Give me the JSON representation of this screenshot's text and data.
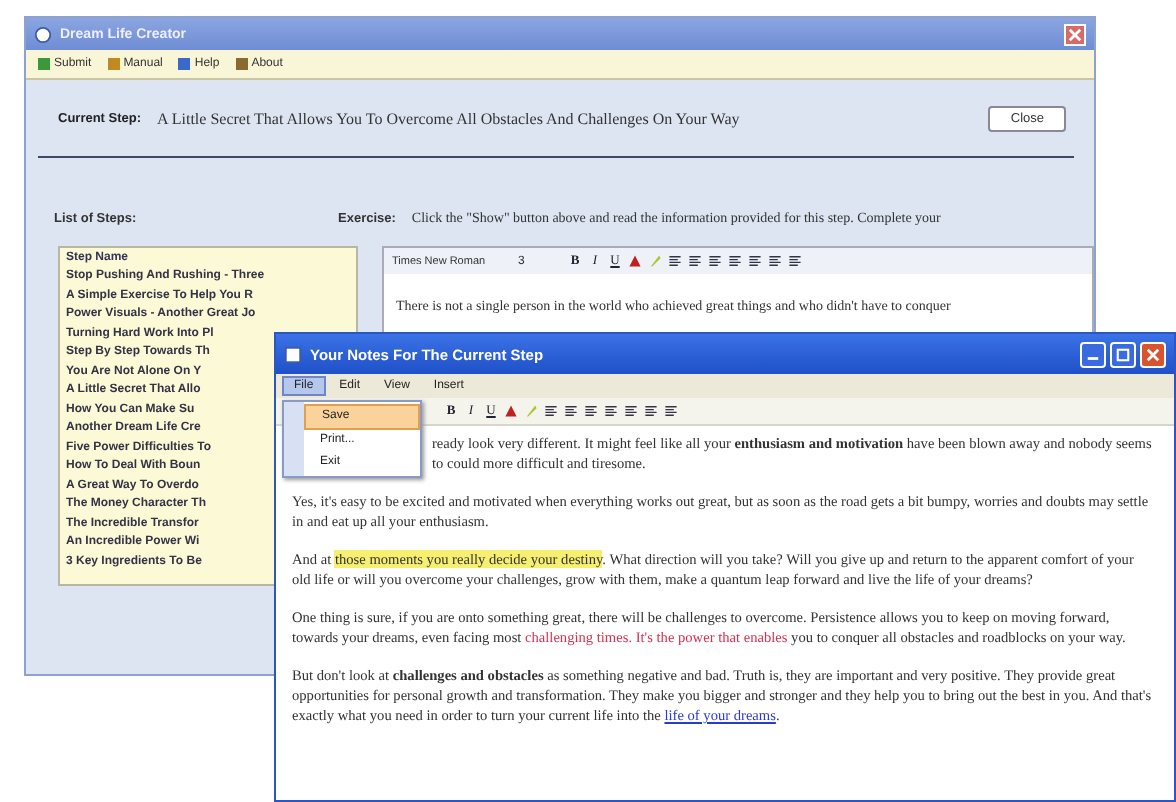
{
  "main_window": {
    "title": "Dream Life Creator",
    "toolbar": [
      {
        "label": "Submit",
        "color": "#3a9a3a"
      },
      {
        "label": "Manual",
        "color": "#c08a20"
      },
      {
        "label": "Help",
        "color": "#3a6ac8"
      },
      {
        "label": "About",
        "color": "#8a6a30"
      }
    ],
    "current_step": {
      "label": "Current Step:",
      "value": "A Little Secret That Allows You To Overcome All Obstacles And Challenges On Your Way"
    },
    "close_button": "Close",
    "steps": {
      "label": "List of Steps:",
      "header": "Step Name",
      "items": [
        "Stop Pushing And Rushing - Three",
        "A Simple Exercise To Help You R",
        "Power Visuals - Another Great Jo",
        "Turning Hard Work Into Pl",
        "Step By Step Towards Th",
        "You Are Not Alone On Y",
        "A Little Secret That Allo",
        "How You Can Make Su",
        "Another Dream Life Cre",
        "Five Power Difficulties To",
        "How To Deal With Boun",
        "A Great Way To Overdo",
        "The Money Character Th",
        "The Incredible Transfor",
        "An Incredible Power Wi",
        "3 Key Ingredients To Be"
      ]
    },
    "exercise": {
      "label": "Exercise:",
      "text": "Click the \"Show\" button above and read the information provided for this step. Complete your"
    },
    "editor": {
      "font": "Times New Roman",
      "size": "3",
      "format_buttons": [
        "B",
        "I",
        "U"
      ],
      "text": "There is not a single person in the world who achieved great things and who didn't have to conquer"
    }
  },
  "notes_window": {
    "title": "Your Notes For The Current Step",
    "menu": [
      {
        "label": "File",
        "selected": true
      },
      {
        "label": "Edit",
        "selected": false
      },
      {
        "label": "View",
        "selected": false
      },
      {
        "label": "Insert",
        "selected": false
      }
    ],
    "file_menu": [
      {
        "label": "Save",
        "selected": true
      },
      {
        "label": "Print...",
        "selected": false
      },
      {
        "label": "Exit",
        "selected": false
      }
    ],
    "format_buttons": [
      "B",
      "I",
      "U"
    ],
    "paragraphs": [
      [
        {
          "kind": "plain",
          "text": "ready look very different. It might feel like all your "
        },
        {
          "kind": "bold",
          "text": "enthusiasm and motivation"
        },
        {
          "kind": "plain",
          "text": " have been blown away and nobody seems to could more difficult and tiresome."
        }
      ],
      [
        {
          "kind": "plain",
          "text": "Yes, it's easy to be excited and motivated when everything works out great, but as soon as the road gets a bit bumpy, worries and doubts may settle in and eat up all your enthusiasm."
        }
      ],
      [
        {
          "kind": "plain",
          "text": "And at "
        },
        {
          "kind": "highlight",
          "text": "those moments you really decide your destiny"
        },
        {
          "kind": "plain",
          "text": ". What direction will you take? Will you give up and return to the apparent comfort of your old life or will you overcome your challenges, grow with them, make a quantum leap forward and live the life of your dreams?"
        }
      ],
      [
        {
          "kind": "plain",
          "text": "One thing is sure, if you are onto something great, there will be challenges to overcome. Persistence allows you to keep on moving forward, towards your dreams, even facing most "
        },
        {
          "kind": "red",
          "text": "challenging times. It's the power that enables"
        },
        {
          "kind": "plain",
          "text": " you to conquer all obstacles and roadblocks on your way."
        }
      ],
      [
        {
          "kind": "plain",
          "text": "But don't look at "
        },
        {
          "kind": "bold",
          "text": "challenges and obstacles"
        },
        {
          "kind": "plain",
          "text": " as something negative and bad. Truth is, they are important and very positive. They provide great opportunities for personal growth and transformation. They make you bigger and stronger and they help you to bring out the best in you. And that's exactly what you need in order to turn your current life into the "
        },
        {
          "kind": "link",
          "text": "life of your dreams"
        },
        {
          "kind": "plain",
          "text": "."
        }
      ]
    ]
  }
}
